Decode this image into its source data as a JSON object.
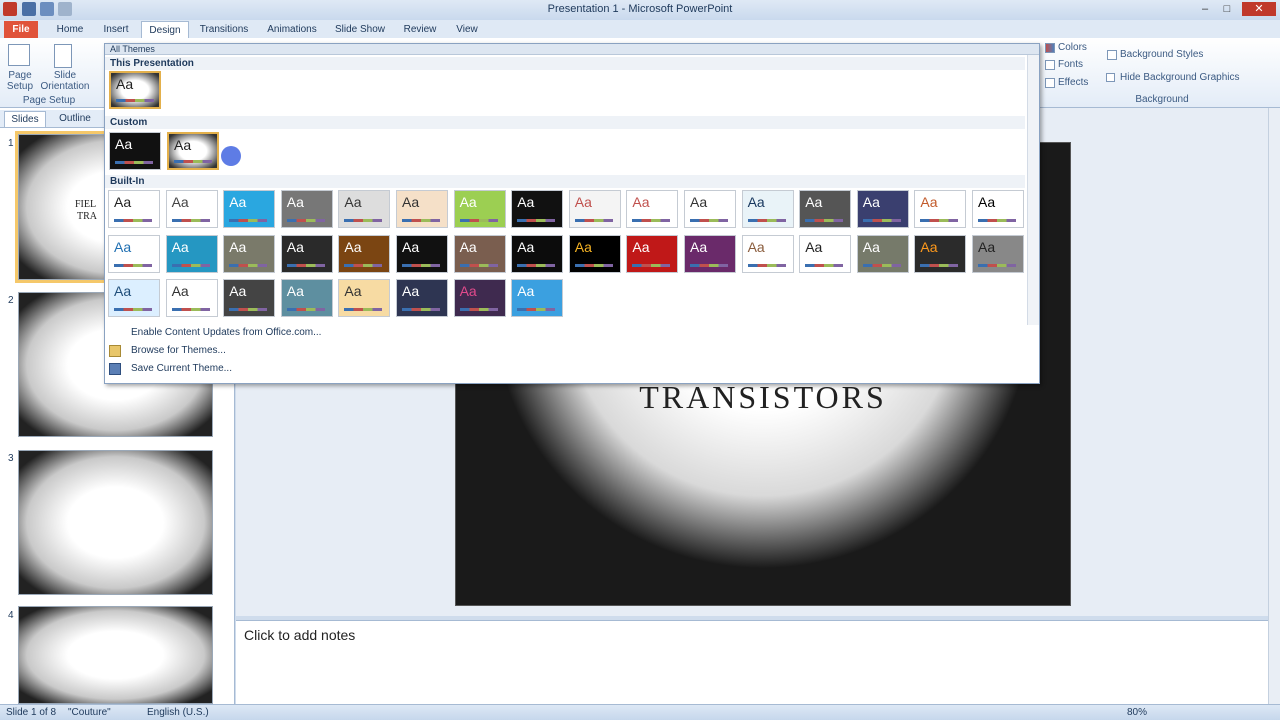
{
  "window": {
    "title": "Presentation 1 - Microsoft PowerPoint"
  },
  "tabs": [
    {
      "label": "File",
      "cls": "file"
    },
    {
      "label": "Home"
    },
    {
      "label": "Insert"
    },
    {
      "label": "Design",
      "active": true
    },
    {
      "label": "Transitions"
    },
    {
      "label": "Animations"
    },
    {
      "label": "Slide Show"
    },
    {
      "label": "Review"
    },
    {
      "label": "View"
    }
  ],
  "ribbon": {
    "page_setup": {
      "label": "Page Setup",
      "group": "Page Setup"
    },
    "slide_orientation": {
      "label": "Slide Orientation"
    },
    "colors": "Colors",
    "fonts": "Fonts",
    "effects": "Effects",
    "background_styles": "Background Styles",
    "hide_bg": "Hide Background Graphics",
    "background_group": "Background"
  },
  "pane_tabs": {
    "slides": "Slides",
    "outline": "Outline"
  },
  "thumbnails": [
    {
      "num": "1",
      "text1": "FIEL",
      "text2": "TRA"
    },
    {
      "num": "2"
    },
    {
      "num": "3"
    },
    {
      "num": "4"
    }
  ],
  "gallery": {
    "header": "All Themes",
    "sec_this": "This Presentation",
    "sec_custom": "Custom",
    "sec_builtin": "Built-In",
    "aa": "Aa",
    "menu": [
      "Enable Content Updates from Office.com...",
      "Browse for Themes...",
      "Save Current Theme..."
    ]
  },
  "slide": {
    "title": "TRANSISTORS"
  },
  "notes": {
    "placeholder": "Click to add notes"
  },
  "status": {
    "slide": "Slide 1 of 8",
    "theme": "\"Couture\"",
    "lang": "English (U.S.)",
    "zoom": "80%"
  }
}
